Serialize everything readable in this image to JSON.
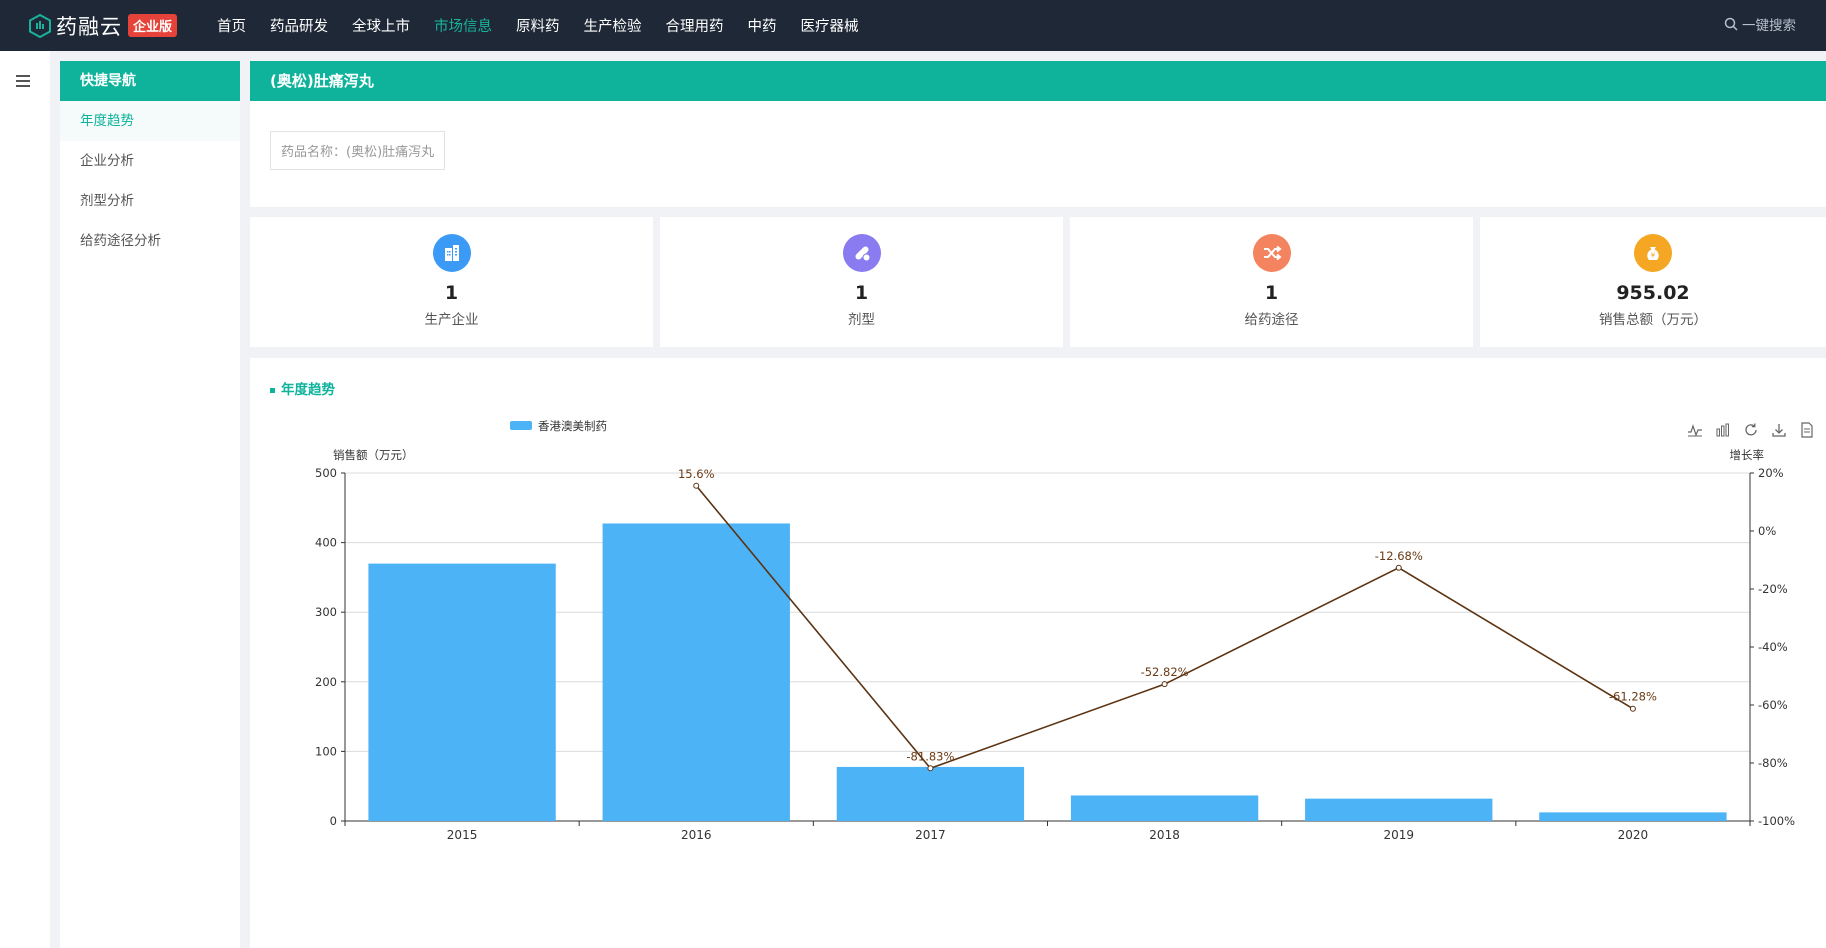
{
  "app": {
    "logo_text": "药融云",
    "logo_badge": "企业版",
    "nav": [
      "首页",
      "药品研发",
      "全球上市",
      "市场信息",
      "原料药",
      "生产检验",
      "合理用药",
      "中药",
      "医疗器械"
    ],
    "active_nav": "市场信息",
    "search_label": "一键搜索"
  },
  "quicknav": {
    "header": "快捷导航",
    "items": [
      "年度趋势",
      "企业分析",
      "剂型分析",
      "给药途径分析"
    ],
    "active": "年度趋势"
  },
  "page": {
    "title": "(奥松)肚痛泻丸",
    "drug_name": "药品名称：(奥松)肚痛泻丸"
  },
  "stats": [
    {
      "value": "1",
      "label": "生产企业",
      "icon": "building-icon",
      "color": "#3b9af5"
    },
    {
      "value": "1",
      "label": "剂型",
      "icon": "pill-icon",
      "color": "#8a7cf0"
    },
    {
      "value": "1",
      "label": "给药途径",
      "icon": "shuffle-icon",
      "color": "#f4845f"
    },
    {
      "value": "955.02",
      "label": "销售总额（万元）",
      "icon": "money-bag-icon",
      "color": "#f5a623"
    }
  ],
  "chart_section_title": "年度趋势",
  "chart_data": {
    "type": "bar",
    "categories": [
      "2015",
      "2016",
      "2017",
      "2018",
      "2019",
      "2020"
    ],
    "series": [
      {
        "name": "香港澳美制药",
        "type": "bar",
        "values": [
          369.8,
          427.5,
          77.7,
          36.7,
          32.1,
          12.4
        ],
        "color": "#4db3f7"
      },
      {
        "type": "line",
        "axis": "right",
        "values": [
          null,
          15.6,
          -81.83,
          -52.82,
          -12.68,
          -61.28
        ],
        "labels": [
          "",
          "15.6%",
          "-81.83%",
          "-52.82%",
          "-12.68%",
          "-61.28%"
        ],
        "color": "#5b3312"
      }
    ],
    "ylabel": "销售额（万元）",
    "ylim": [
      0,
      500
    ],
    "yticks": [
      "0",
      "100",
      "200",
      "300",
      "400",
      "500"
    ],
    "y2label": "增长率",
    "y2lim": [
      -100,
      20
    ],
    "y2ticks": [
      "20%",
      "0%",
      "-20%",
      "-40%",
      "-60%",
      "-80%",
      "-100%"
    ],
    "grid": true,
    "legend_position": "top-left"
  }
}
